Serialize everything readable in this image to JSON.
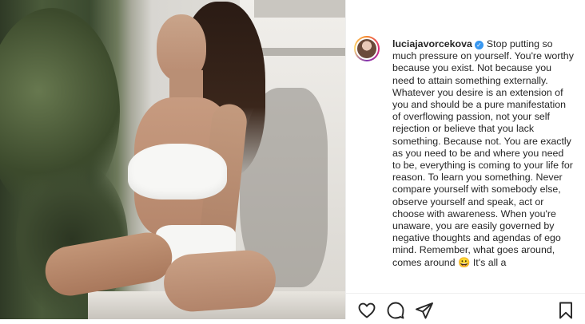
{
  "post": {
    "author": {
      "username": "luciajavorcekova",
      "verified": true
    },
    "caption": "Stop putting so much pressure on yourself. You're worthy because you exist. Not because you need to attain something externally. Whatever you desire is an extension of you and should be a pure manifestation of overflowing passion, not your self rejection or believe that you lack something. Because not. You are exactly as you need to be and where you need to be, everything is coming to your life for reason. To learn you something. Never compare yourself with somebody else, observe yourself and speak, act or choose with awareness. When you're unaware, you are easily governed by negative thoughts and agendas of ego mind. Remember, what goes around, comes around 😀 It's all a"
  },
  "actions": {
    "like_icon": "heart-icon",
    "comment_icon": "comment-icon",
    "share_icon": "paper-plane-icon",
    "save_icon": "bookmark-icon"
  },
  "colors": {
    "text": "#262626",
    "verified_badge": "#3897f0",
    "divider": "#efefef"
  }
}
